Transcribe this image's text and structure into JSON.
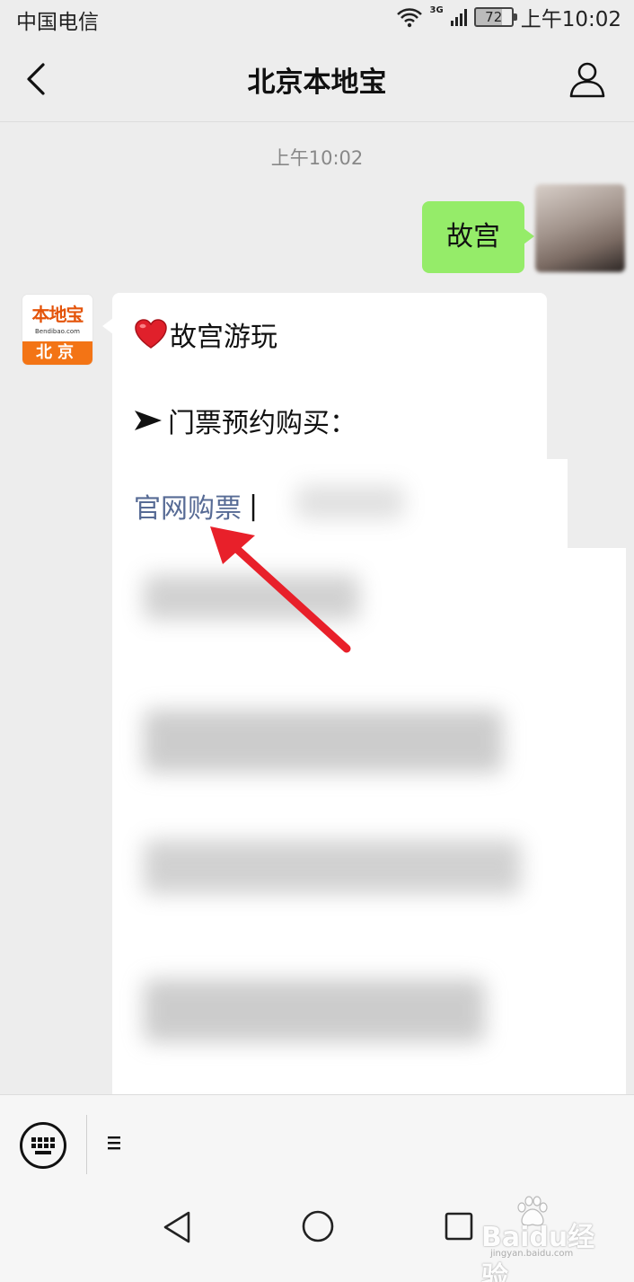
{
  "status_bar": {
    "carrier": "中国电信",
    "network": "3G",
    "battery": "72",
    "time": "上午10:02"
  },
  "header": {
    "title": "北京本地宝"
  },
  "chat": {
    "timestamp": "上午10:02",
    "outgoing": {
      "text": "故宫"
    },
    "bot_avatar": {
      "brand": "本地宝",
      "site": "Bendibao.com",
      "city": "北京"
    },
    "incoming": {
      "line1": "故宫游玩",
      "line2": "门票预约购买：",
      "link": "官网购票",
      "separator": "|"
    }
  },
  "watermark": {
    "brand": "Baidu经验",
    "site": "jingyan.baidu.com"
  },
  "colors": {
    "bubble_out": "#95ec69",
    "link": "#576b95",
    "annotation_arrow": "#e8202a",
    "background": "#ededed"
  }
}
